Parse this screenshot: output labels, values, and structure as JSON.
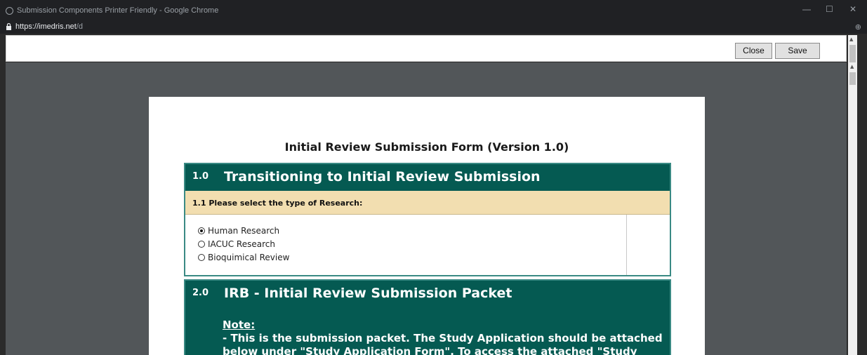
{
  "window": {
    "title": "Submission Components Printer Friendly - Google Chrome",
    "url_host": "https://imedris.net",
    "url_path": "/d"
  },
  "toolbar": {
    "close_label": "Close",
    "save_label": "Save"
  },
  "form": {
    "title": "Initial Review Submission Form (Version 1.0)",
    "section1": {
      "number": "1.0",
      "title": "Transitioning to Initial Review Submission",
      "question": "1.1  Please select the type of Research:",
      "options": [
        {
          "label": "Human Research",
          "checked": true
        },
        {
          "label": "IACUC Research",
          "checked": false
        },
        {
          "label": "Bioquimical Review",
          "checked": false
        }
      ]
    },
    "section2": {
      "number": "2.0",
      "title": "IRB - Initial Review Submission Packet",
      "note_label": "Note:",
      "note_lines": [
        "- This is the submission packet. The Study Application should be attached",
        "below under \"Study Application Form\". To access the attached \"Study"
      ]
    }
  },
  "icons": [
    "chrome-icon",
    "lock-icon",
    "zoom-icon",
    "minimize-icon",
    "maximize-icon",
    "close-window-icon"
  ]
}
